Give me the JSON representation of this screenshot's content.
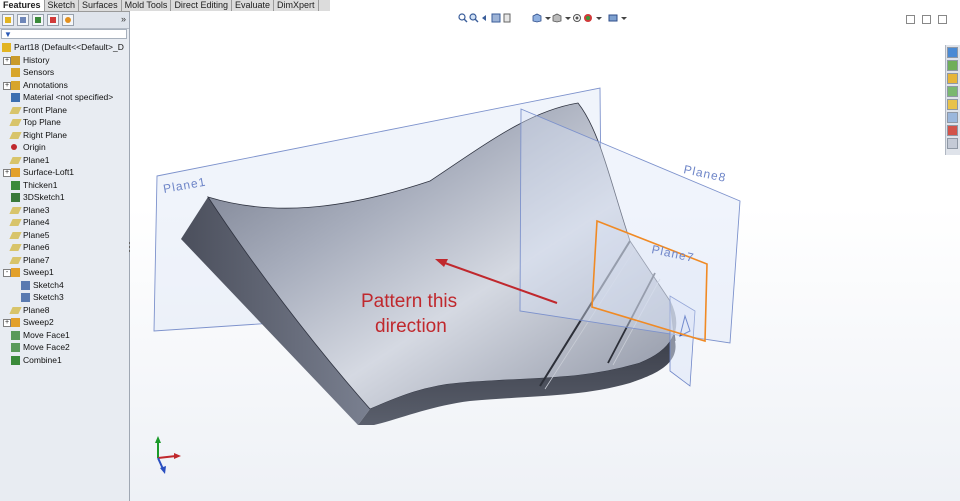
{
  "tabs": [
    "Features",
    "Sketch",
    "Surfaces",
    "Mold Tools",
    "Direct Editing",
    "Evaluate",
    "DimXpert"
  ],
  "feature_tree": [
    {
      "label": "Part18  (Default<<Default>_D",
      "icon": "part-icon",
      "indent": 0
    },
    {
      "label": "History",
      "icon": "history-icon",
      "indent": 1,
      "expander": "+"
    },
    {
      "label": "Sensors",
      "icon": "sensors-icon",
      "indent": 1
    },
    {
      "label": "Annotations",
      "icon": "annotations-icon",
      "indent": 1,
      "expander": "+"
    },
    {
      "label": "Material <not specified>",
      "icon": "material-icon",
      "indent": 1
    },
    {
      "label": "Front Plane",
      "icon": "plane-icon",
      "indent": 1
    },
    {
      "label": "Top Plane",
      "icon": "plane-icon",
      "indent": 1
    },
    {
      "label": "Right Plane",
      "icon": "plane-icon",
      "indent": 1
    },
    {
      "label": "Origin",
      "icon": "origin-icon",
      "indent": 1
    },
    {
      "label": "Plane1",
      "icon": "plane-icon",
      "indent": 1
    },
    {
      "label": "Surface-Loft1",
      "icon": "surface-loft-icon",
      "indent": 1,
      "expander": "+"
    },
    {
      "label": "Thicken1",
      "icon": "thicken-icon",
      "indent": 1
    },
    {
      "label": "3DSketch1",
      "icon": "sketch-3d-icon",
      "indent": 1
    },
    {
      "label": "Plane3",
      "icon": "plane-icon",
      "indent": 1
    },
    {
      "label": "Plane4",
      "icon": "plane-icon",
      "indent": 1
    },
    {
      "label": "Plane5",
      "icon": "plane-icon",
      "indent": 1
    },
    {
      "label": "Plane6",
      "icon": "plane-icon",
      "indent": 1
    },
    {
      "label": "Plane7",
      "icon": "plane-icon",
      "indent": 1
    },
    {
      "label": "Sweep1",
      "icon": "sweep-icon",
      "indent": 1,
      "expander": "-"
    },
    {
      "label": "Sketch4",
      "icon": "sketch-icon",
      "indent": 2
    },
    {
      "label": "Sketch3",
      "icon": "sketch-icon",
      "indent": 2
    },
    {
      "label": "Plane8",
      "icon": "plane-icon",
      "indent": 1
    },
    {
      "label": "Sweep2",
      "icon": "sweep-icon",
      "indent": 1,
      "expander": "+"
    },
    {
      "label": "Move Face1",
      "icon": "move-face-icon",
      "indent": 1
    },
    {
      "label": "Move Face2",
      "icon": "move-face-icon",
      "indent": 1
    },
    {
      "label": "Combine1",
      "icon": "combine-icon",
      "indent": 1
    }
  ],
  "viewport": {
    "plane_labels": {
      "plane1": "Plane1",
      "plane8": "Plane8",
      "plane7": "Plane7"
    },
    "annotation_line1": "Pattern this",
    "annotation_line2": "direction"
  },
  "colors": {
    "plane_edge": "#6f86c8",
    "plane_fill": "#d9e3f7",
    "highlight_plane": "#f08a24",
    "annotation_text": "#c0282d",
    "arrow": "#c0282d",
    "solid_top": "#8d94a6",
    "solid_side": "#3f4350"
  }
}
